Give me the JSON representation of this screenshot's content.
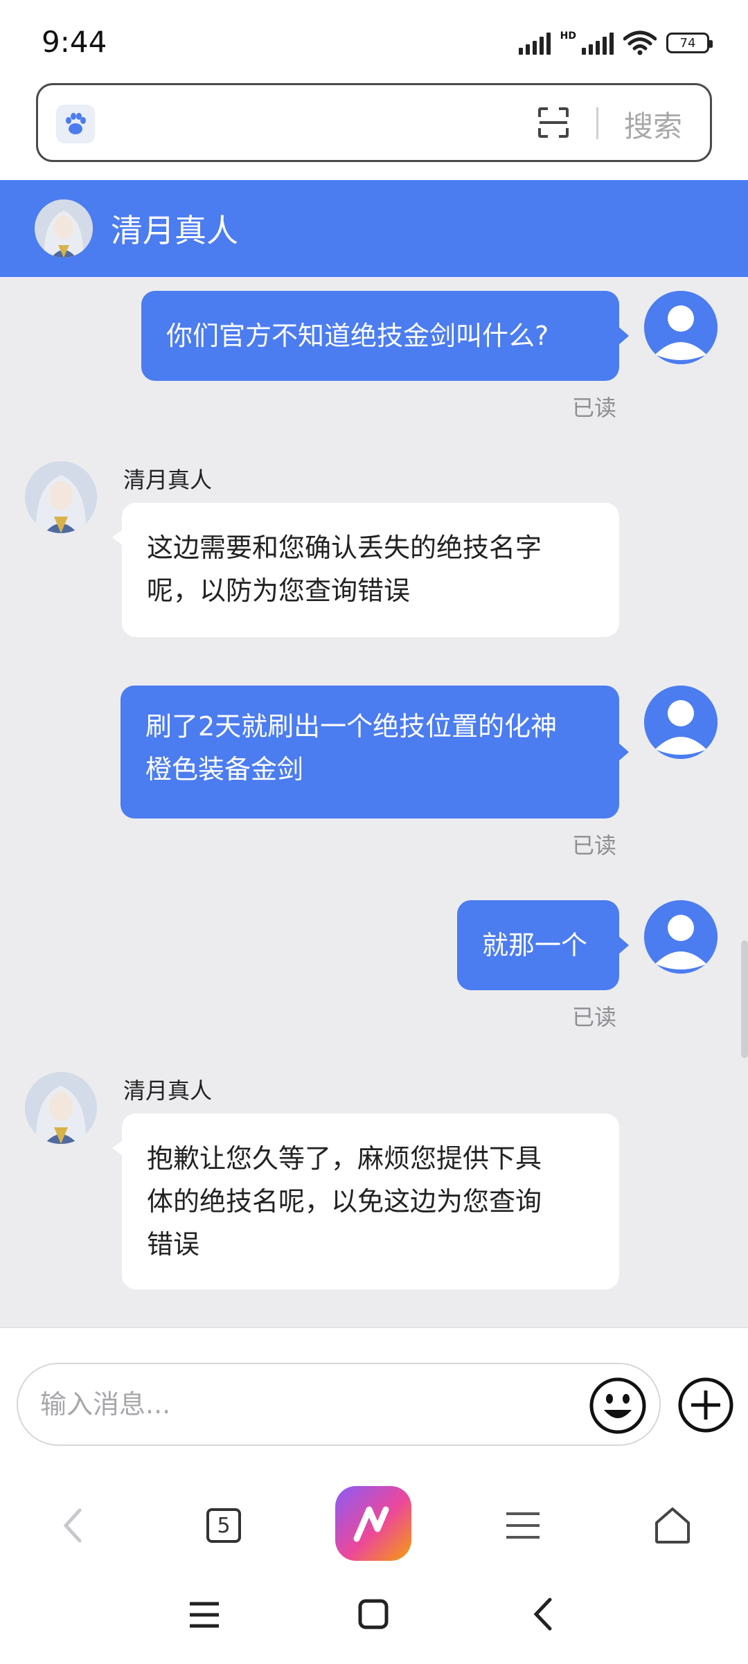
{
  "status_bar": {
    "time": "9:44",
    "network_label": "HD",
    "battery": "74"
  },
  "search": {
    "button_label": "搜索",
    "icons": [
      "paw-icon",
      "scan-icon"
    ]
  },
  "chat": {
    "title": "清月真人",
    "messages": [
      {
        "direction": "out",
        "text": "你们官方不知道绝技金剑叫什么?",
        "status": "已读"
      },
      {
        "direction": "in",
        "sender": "清月真人",
        "lines": [
          "这边需要和您确认丢失的绝技名字",
          "呢，以防为您查询错误"
        ]
      },
      {
        "direction": "out",
        "lines": [
          "刷了2天就刷出一个绝技位置的化神",
          "橙色装备金剑"
        ],
        "status": "已读"
      },
      {
        "direction": "out",
        "text": "就那一个",
        "status": "已读"
      },
      {
        "direction": "in",
        "sender": "清月真人",
        "lines": [
          "抱歉让您久等了，麻烦您提供下具",
          "体的绝技名呢，以免这边为您查询",
          "错误"
        ]
      }
    ]
  },
  "input": {
    "placeholder": "输入消息...",
    "icons": [
      "emoji-icon",
      "plus-icon"
    ]
  },
  "browser_nav": {
    "tab_count": "5",
    "icons": [
      "back-icon",
      "tabs-icon",
      "ai-assistant-icon",
      "menu-icon",
      "home-icon"
    ]
  },
  "system_nav": {
    "icons": [
      "recents-icon",
      "home-square-icon",
      "back-chevron-icon"
    ]
  },
  "colors": {
    "accent": "#4b7cf0",
    "chat_background": "#ececef",
    "read_status": "#8e8e93"
  }
}
